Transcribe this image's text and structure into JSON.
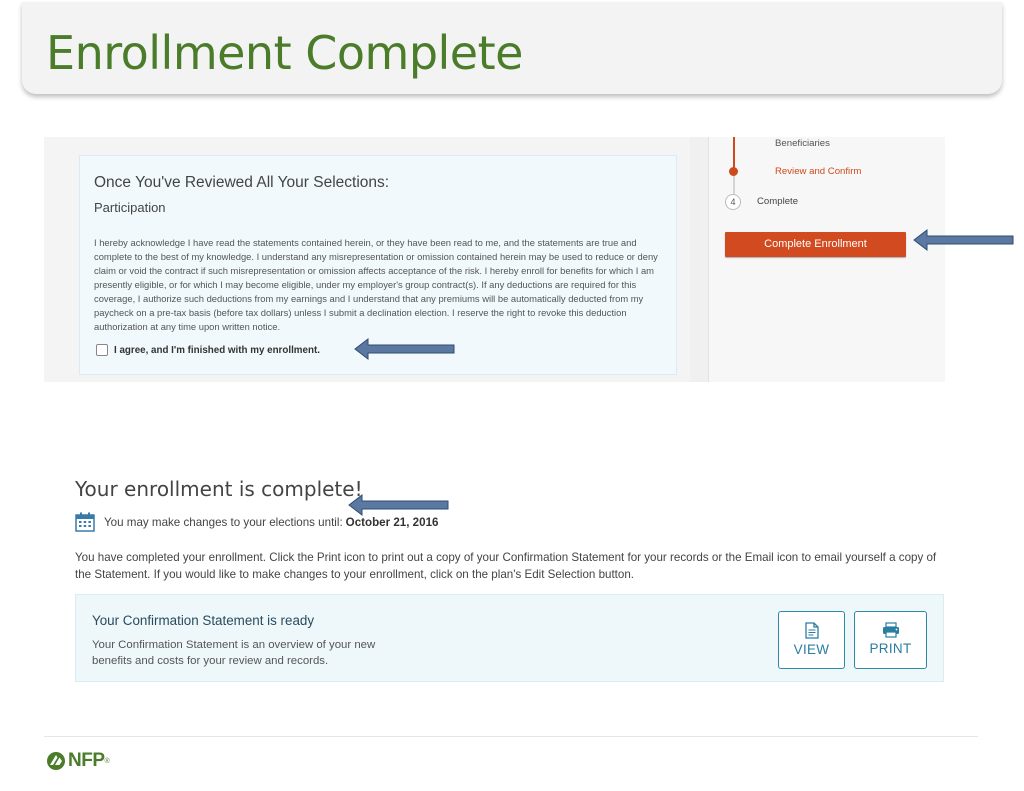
{
  "slide": {
    "title": "Enrollment Complete"
  },
  "review_panel": {
    "heading": "Once You've Reviewed All Your Selections:",
    "subheading": "Participation",
    "legal_text": "I hereby acknowledge I have read the statements contained herein, or they have been read to me, and the statements are true and complete to the best of my knowledge. I understand any misrepresentation or omission contained herein may be used to reduce or deny claim or void the contract if such misrepresentation or omission affects acceptance of the risk. I hereby enroll for benefits for which I am presently eligible, or for which I may become eligible, under my employer's group contract(s). If any deductions are required for this coverage, I authorize such deductions from my earnings and I understand that any premiums will be automatically deducted from my paycheck on a pre-tax basis (before tax dollars) unless I submit a declination election. I reserve the right to revoke this deduction authorization at any time upon written notice.",
    "agree_label": "I agree, and I'm finished with my enrollment.",
    "agree_checked": false
  },
  "steps": {
    "beneficiaries": "Beneficiaries",
    "review": "Review and Confirm",
    "complete_number": "4",
    "complete": "Complete",
    "complete_button": "Complete Enrollment"
  },
  "confirmation": {
    "heading": "Your enrollment is complete!",
    "deadline_prefix": "You may make changes to your elections until:",
    "deadline_date": "October 21, 2016",
    "info": "You have completed your enrollment. Click the Print icon to print out a copy of your Confirmation Statement for your records or the Email icon to email yourself a copy of the Statement. If you would like to make changes to your enrollment, click on the plan's Edit Selection button.",
    "statement_title": "Your Confirmation Statement is ready",
    "statement_desc": "Your Confirmation Statement is an overview of your new benefits and costs for your review and records.",
    "view_label": "VIEW",
    "print_label": "PRINT"
  },
  "footer": {
    "logo_text": "NFP",
    "logo_mark": "®"
  },
  "colors": {
    "title_green": "#4a7c2a",
    "accent_orange": "#d24a1f",
    "button_teal": "#2a7ea0",
    "arrow_fill": "#5a78a0"
  },
  "icons": {
    "calendar": "calendar-icon",
    "view": "document-icon",
    "print": "printer-icon",
    "logo": "nfp-logo-icon",
    "pointer": "callout-arrow-icon"
  }
}
